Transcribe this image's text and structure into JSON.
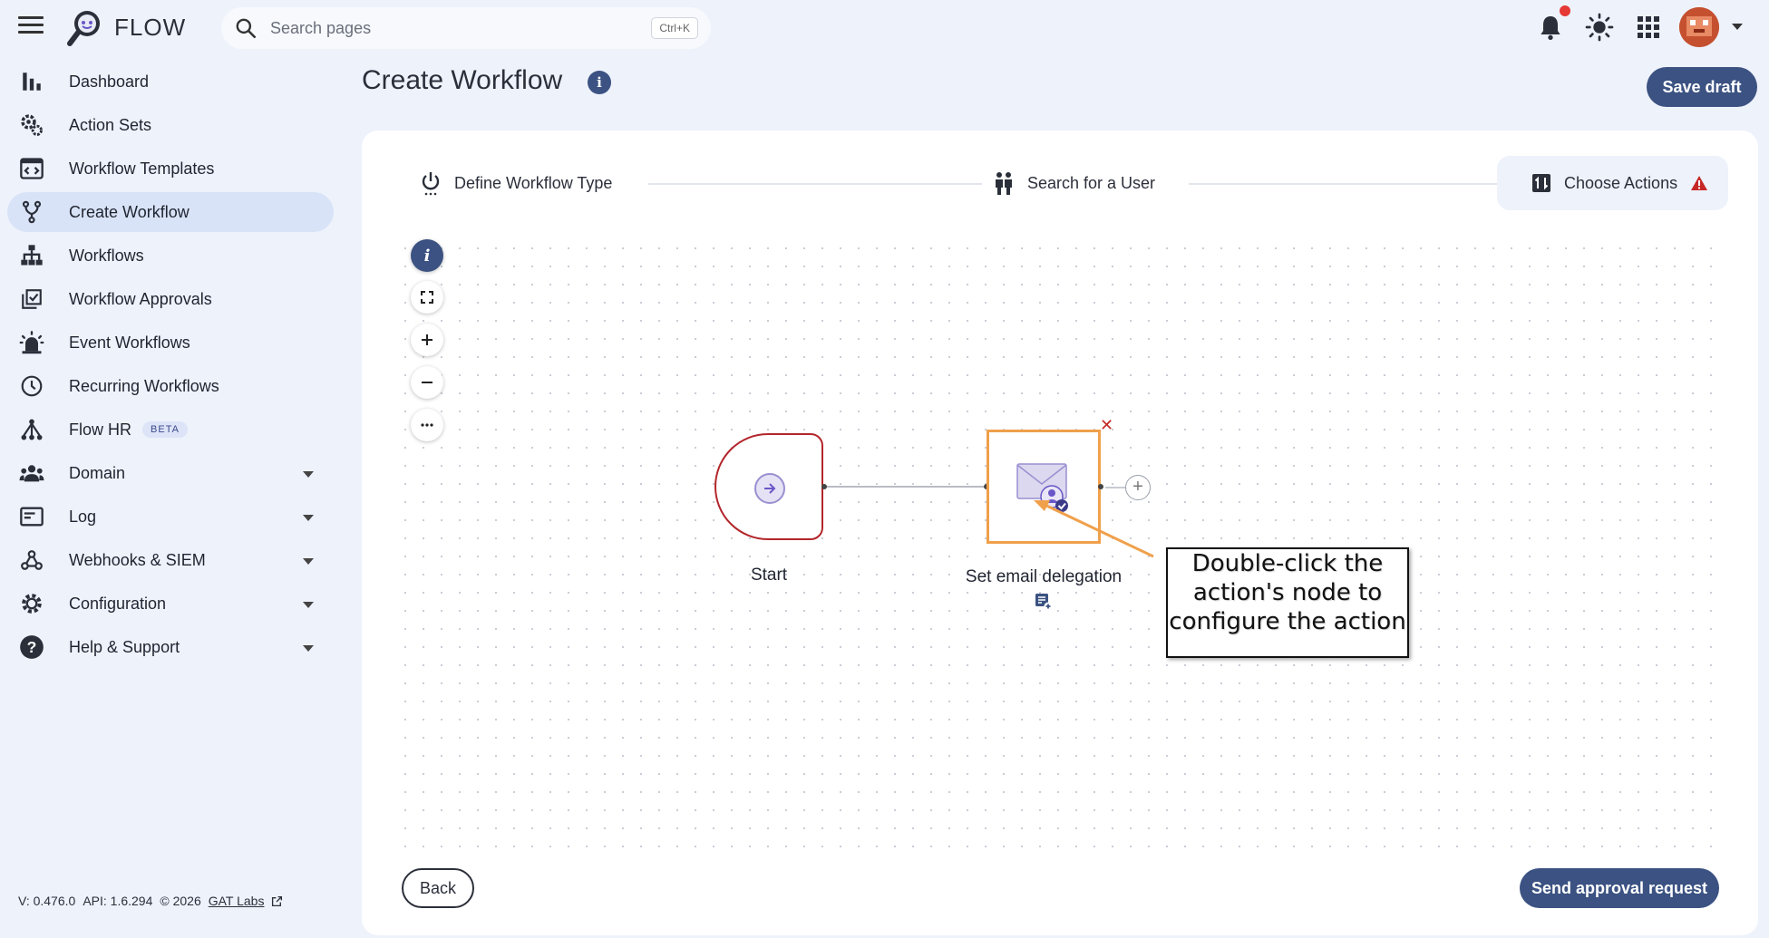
{
  "app": {
    "name": "FLOW"
  },
  "search": {
    "placeholder": "Search pages",
    "shortcut": "Ctrl+K"
  },
  "topbar": {
    "icons": [
      "bell-icon",
      "sun-icon",
      "apps-grid-icon",
      "avatar"
    ]
  },
  "sidebar": {
    "items": [
      {
        "label": "Dashboard",
        "icon": "bar-chart-icon"
      },
      {
        "label": "Action Sets",
        "icon": "gears-icon"
      },
      {
        "label": "Workflow Templates",
        "icon": "template-icon"
      },
      {
        "label": "Create Workflow",
        "icon": "fork-icon",
        "active": true
      },
      {
        "label": "Workflows",
        "icon": "sitemap-icon"
      },
      {
        "label": "Workflow Approvals",
        "icon": "approval-icon"
      },
      {
        "label": "Event Workflows",
        "icon": "alarm-icon"
      },
      {
        "label": "Recurring Workflows",
        "icon": "clock-icon"
      },
      {
        "label": "Flow HR",
        "icon": "hierarchy-icon",
        "badge": "BETA"
      },
      {
        "label": "Domain",
        "icon": "group-icon",
        "expandable": true
      },
      {
        "label": "Log",
        "icon": "log-icon",
        "expandable": true
      },
      {
        "label": "Webhooks & SIEM",
        "icon": "webhook-icon",
        "expandable": true
      },
      {
        "label": "Configuration",
        "icon": "gear-icon",
        "expandable": true
      },
      {
        "label": "Help & Support",
        "icon": "help-icon",
        "expandable": true
      }
    ]
  },
  "footer": {
    "version": "V: 0.476.0",
    "api": "API: 1.6.294",
    "copyright": "© 2026",
    "company": "GAT Labs"
  },
  "header": {
    "title": "Create Workflow",
    "save_label": "Save draft"
  },
  "steps": [
    {
      "label": "Define Workflow Type",
      "icon": "power-icon"
    },
    {
      "label": "Search for a User",
      "icon": "users-icon"
    },
    {
      "label": "Choose Actions",
      "icon": "swap-icon",
      "active": true,
      "warning": true
    }
  ],
  "canvas": {
    "controls": [
      "info",
      "fit-view",
      "zoom-in",
      "zoom-out",
      "more"
    ],
    "start_label": "Start",
    "action_label": "Set email delegation"
  },
  "callout": {
    "text": "Double-click the action's node to configure the action"
  },
  "actions": {
    "back": "Back",
    "send": "Send approval request"
  },
  "colors": {
    "primary": "#3b5282",
    "start_border": "#b3262b",
    "selected_node": "#f0a04b",
    "warning": "#c62828"
  }
}
